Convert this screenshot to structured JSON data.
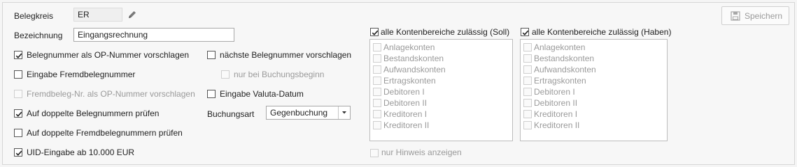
{
  "form": {
    "belegkreis": {
      "label": "Belegkreis",
      "value": "ER"
    },
    "bezeichnung": {
      "label": "Bezeichnung",
      "value": "Eingangsrechnung"
    },
    "left_checkboxes": [
      {
        "label": "Belegnummer als OP-Nummer vorschlagen",
        "checked": true,
        "disabled": false
      },
      {
        "label": "Eingabe Fremdbelegnummer",
        "checked": false,
        "disabled": false
      },
      {
        "label": "Fremdbeleg-Nr. als OP-Nummer vorschlagen",
        "checked": false,
        "disabled": true
      },
      {
        "label": "Auf doppelte Belegnummern prüfen",
        "checked": true,
        "disabled": false
      },
      {
        "label": "Auf doppelte Fremdbelegnummern prüfen",
        "checked": false,
        "disabled": false
      },
      {
        "label": "UID-Eingabe ab 10.000 EUR",
        "checked": true,
        "disabled": false
      }
    ],
    "mid_checkboxes": [
      {
        "label": "nächste Belegnummer vorschlagen",
        "checked": false,
        "disabled": false
      },
      {
        "label": "nur bei Buchungsbeginn",
        "checked": false,
        "disabled": true
      },
      {
        "label": "Eingabe Valuta-Datum",
        "checked": false,
        "disabled": false
      }
    ],
    "buchungsart": {
      "label": "Buchungsart",
      "value": "Gegenbuchung"
    }
  },
  "soll": {
    "header": "alle Kontenbereiche zulässig (Soll)",
    "checked": true,
    "items": [
      "Anlagekonten",
      "Bestandskonten",
      "Aufwandskonten",
      "Ertragskonten",
      "Debitoren I",
      "Debitoren II",
      "Kreditoren I",
      "Kreditoren II"
    ]
  },
  "haben": {
    "header": "alle Kontenbereiche zulässig (Haben)",
    "checked": true,
    "items": [
      "Anlagekonten",
      "Bestandskonten",
      "Aufwandskonten",
      "Ertragskonten",
      "Debitoren I",
      "Debitoren II",
      "Kreditoren I",
      "Kreditoren II"
    ]
  },
  "nur_hinweis": {
    "label": "nur Hinweis anzeigen",
    "checked": false,
    "disabled": true
  },
  "toolbar": {
    "save_label": "Speichern"
  },
  "icons": {
    "edit": "pencil-icon",
    "save": "save-icon",
    "dropdown": "chevron-down-icon",
    "check": "checkmark-icon"
  }
}
